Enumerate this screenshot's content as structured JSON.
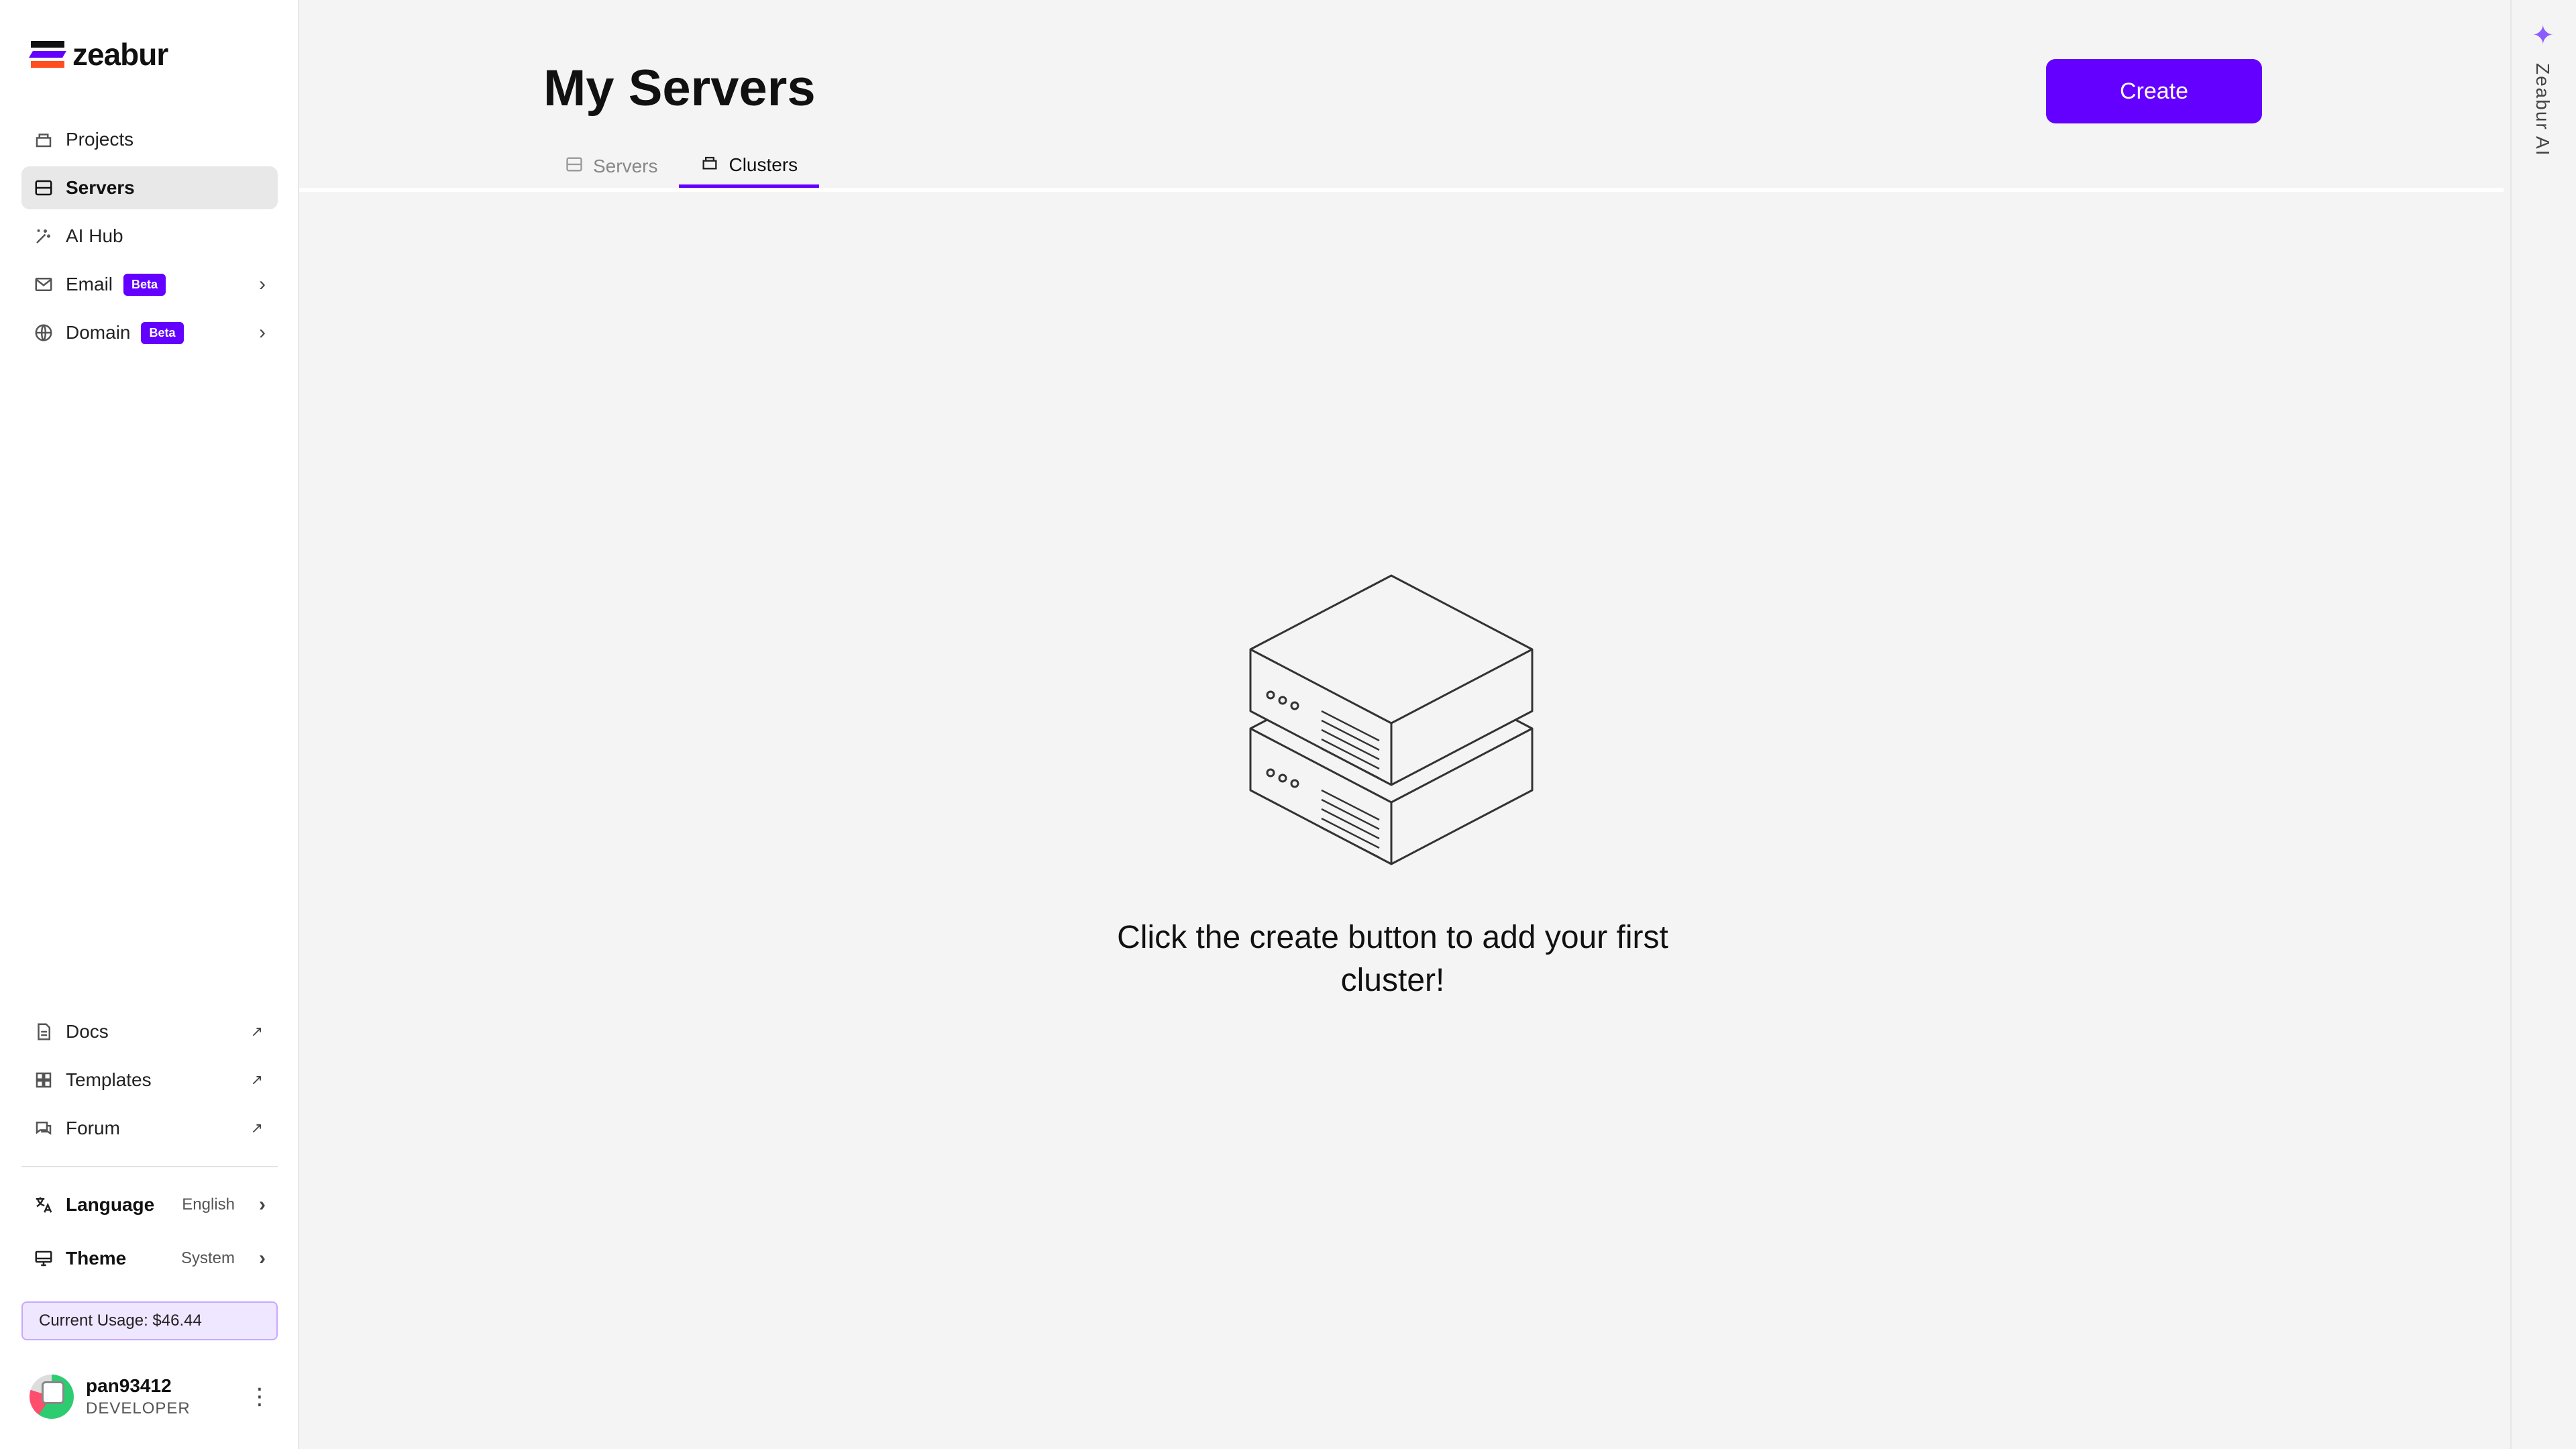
{
  "brand": {
    "name": "zeabur"
  },
  "sidebar": {
    "items": [
      {
        "label": "Projects",
        "icon": "projects-icon"
      },
      {
        "label": "Servers",
        "icon": "servers-icon",
        "active": true
      },
      {
        "label": "AI Hub",
        "icon": "ai-hub-icon"
      },
      {
        "label": "Email",
        "icon": "email-icon",
        "badge": "Beta"
      },
      {
        "label": "Domain",
        "icon": "globe-icon",
        "badge": "Beta"
      }
    ],
    "links": [
      {
        "label": "Docs",
        "icon": "docs-icon"
      },
      {
        "label": "Templates",
        "icon": "templates-icon"
      },
      {
        "label": "Forum",
        "icon": "forum-icon"
      }
    ],
    "language": {
      "label": "Language",
      "value": "English"
    },
    "theme": {
      "label": "Theme",
      "value": "System"
    },
    "usage": "Current Usage: $46.44",
    "user": {
      "name": "pan93412",
      "role": "DEVELOPER"
    }
  },
  "main": {
    "title": "My Servers",
    "create_label": "Create",
    "tabs": [
      {
        "label": "Servers"
      },
      {
        "label": "Clusters",
        "active": true
      }
    ],
    "empty_text": "Click the create button to add your first cluster!"
  },
  "ai_rail": {
    "label": "Zeabur AI"
  },
  "colors": {
    "accent": "#6300ff",
    "background": "#f4f4f4"
  }
}
